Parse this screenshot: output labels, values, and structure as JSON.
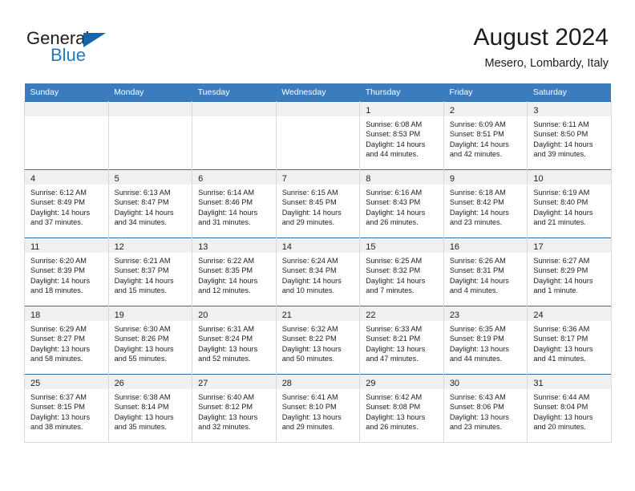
{
  "brand": {
    "name_part1": "General",
    "name_part2": "Blue",
    "flag_icon": "blue-triangle-flag-icon",
    "accent_color": "#1f7ac0"
  },
  "header": {
    "title": "August 2024",
    "subtitle": "Mesero, Lombardy, Italy"
  },
  "theme": {
    "header_row_bg": "#3a7cbe",
    "row_divider": "#2f6da8",
    "daynum_bar_bg": "#f0f0f0",
    "cell_border": "#d9d9d9"
  },
  "calendar": {
    "weekday_headers": [
      "Sunday",
      "Monday",
      "Tuesday",
      "Wednesday",
      "Thursday",
      "Friday",
      "Saturday"
    ],
    "weeks": [
      [
        {
          "day": "",
          "sunrise": "",
          "sunset": "",
          "daylight1": "",
          "daylight2": "",
          "empty": true
        },
        {
          "day": "",
          "sunrise": "",
          "sunset": "",
          "daylight1": "",
          "daylight2": "",
          "empty": true
        },
        {
          "day": "",
          "sunrise": "",
          "sunset": "",
          "daylight1": "",
          "daylight2": "",
          "empty": true
        },
        {
          "day": "",
          "sunrise": "",
          "sunset": "",
          "daylight1": "",
          "daylight2": "",
          "empty": true
        },
        {
          "day": "1",
          "sunrise": "Sunrise: 6:08 AM",
          "sunset": "Sunset: 8:53 PM",
          "daylight1": "Daylight: 14 hours",
          "daylight2": "and 44 minutes.",
          "empty": false
        },
        {
          "day": "2",
          "sunrise": "Sunrise: 6:09 AM",
          "sunset": "Sunset: 8:51 PM",
          "daylight1": "Daylight: 14 hours",
          "daylight2": "and 42 minutes.",
          "empty": false
        },
        {
          "day": "3",
          "sunrise": "Sunrise: 6:11 AM",
          "sunset": "Sunset: 8:50 PM",
          "daylight1": "Daylight: 14 hours",
          "daylight2": "and 39 minutes.",
          "empty": false
        }
      ],
      [
        {
          "day": "4",
          "sunrise": "Sunrise: 6:12 AM",
          "sunset": "Sunset: 8:49 PM",
          "daylight1": "Daylight: 14 hours",
          "daylight2": "and 37 minutes.",
          "empty": false
        },
        {
          "day": "5",
          "sunrise": "Sunrise: 6:13 AM",
          "sunset": "Sunset: 8:47 PM",
          "daylight1": "Daylight: 14 hours",
          "daylight2": "and 34 minutes.",
          "empty": false
        },
        {
          "day": "6",
          "sunrise": "Sunrise: 6:14 AM",
          "sunset": "Sunset: 8:46 PM",
          "daylight1": "Daylight: 14 hours",
          "daylight2": "and 31 minutes.",
          "empty": false
        },
        {
          "day": "7",
          "sunrise": "Sunrise: 6:15 AM",
          "sunset": "Sunset: 8:45 PM",
          "daylight1": "Daylight: 14 hours",
          "daylight2": "and 29 minutes.",
          "empty": false
        },
        {
          "day": "8",
          "sunrise": "Sunrise: 6:16 AM",
          "sunset": "Sunset: 8:43 PM",
          "daylight1": "Daylight: 14 hours",
          "daylight2": "and 26 minutes.",
          "empty": false
        },
        {
          "day": "9",
          "sunrise": "Sunrise: 6:18 AM",
          "sunset": "Sunset: 8:42 PM",
          "daylight1": "Daylight: 14 hours",
          "daylight2": "and 23 minutes.",
          "empty": false
        },
        {
          "day": "10",
          "sunrise": "Sunrise: 6:19 AM",
          "sunset": "Sunset: 8:40 PM",
          "daylight1": "Daylight: 14 hours",
          "daylight2": "and 21 minutes.",
          "empty": false
        }
      ],
      [
        {
          "day": "11",
          "sunrise": "Sunrise: 6:20 AM",
          "sunset": "Sunset: 8:39 PM",
          "daylight1": "Daylight: 14 hours",
          "daylight2": "and 18 minutes.",
          "empty": false
        },
        {
          "day": "12",
          "sunrise": "Sunrise: 6:21 AM",
          "sunset": "Sunset: 8:37 PM",
          "daylight1": "Daylight: 14 hours",
          "daylight2": "and 15 minutes.",
          "empty": false
        },
        {
          "day": "13",
          "sunrise": "Sunrise: 6:22 AM",
          "sunset": "Sunset: 8:35 PM",
          "daylight1": "Daylight: 14 hours",
          "daylight2": "and 12 minutes.",
          "empty": false
        },
        {
          "day": "14",
          "sunrise": "Sunrise: 6:24 AM",
          "sunset": "Sunset: 8:34 PM",
          "daylight1": "Daylight: 14 hours",
          "daylight2": "and 10 minutes.",
          "empty": false
        },
        {
          "day": "15",
          "sunrise": "Sunrise: 6:25 AM",
          "sunset": "Sunset: 8:32 PM",
          "daylight1": "Daylight: 14 hours",
          "daylight2": "and 7 minutes.",
          "empty": false
        },
        {
          "day": "16",
          "sunrise": "Sunrise: 6:26 AM",
          "sunset": "Sunset: 8:31 PM",
          "daylight1": "Daylight: 14 hours",
          "daylight2": "and 4 minutes.",
          "empty": false
        },
        {
          "day": "17",
          "sunrise": "Sunrise: 6:27 AM",
          "sunset": "Sunset: 8:29 PM",
          "daylight1": "Daylight: 14 hours",
          "daylight2": "and 1 minute.",
          "empty": false
        }
      ],
      [
        {
          "day": "18",
          "sunrise": "Sunrise: 6:29 AM",
          "sunset": "Sunset: 8:27 PM",
          "daylight1": "Daylight: 13 hours",
          "daylight2": "and 58 minutes.",
          "empty": false
        },
        {
          "day": "19",
          "sunrise": "Sunrise: 6:30 AM",
          "sunset": "Sunset: 8:26 PM",
          "daylight1": "Daylight: 13 hours",
          "daylight2": "and 55 minutes.",
          "empty": false
        },
        {
          "day": "20",
          "sunrise": "Sunrise: 6:31 AM",
          "sunset": "Sunset: 8:24 PM",
          "daylight1": "Daylight: 13 hours",
          "daylight2": "and 52 minutes.",
          "empty": false
        },
        {
          "day": "21",
          "sunrise": "Sunrise: 6:32 AM",
          "sunset": "Sunset: 8:22 PM",
          "daylight1": "Daylight: 13 hours",
          "daylight2": "and 50 minutes.",
          "empty": false
        },
        {
          "day": "22",
          "sunrise": "Sunrise: 6:33 AM",
          "sunset": "Sunset: 8:21 PM",
          "daylight1": "Daylight: 13 hours",
          "daylight2": "and 47 minutes.",
          "empty": false
        },
        {
          "day": "23",
          "sunrise": "Sunrise: 6:35 AM",
          "sunset": "Sunset: 8:19 PM",
          "daylight1": "Daylight: 13 hours",
          "daylight2": "and 44 minutes.",
          "empty": false
        },
        {
          "day": "24",
          "sunrise": "Sunrise: 6:36 AM",
          "sunset": "Sunset: 8:17 PM",
          "daylight1": "Daylight: 13 hours",
          "daylight2": "and 41 minutes.",
          "empty": false
        }
      ],
      [
        {
          "day": "25",
          "sunrise": "Sunrise: 6:37 AM",
          "sunset": "Sunset: 8:15 PM",
          "daylight1": "Daylight: 13 hours",
          "daylight2": "and 38 minutes.",
          "empty": false
        },
        {
          "day": "26",
          "sunrise": "Sunrise: 6:38 AM",
          "sunset": "Sunset: 8:14 PM",
          "daylight1": "Daylight: 13 hours",
          "daylight2": "and 35 minutes.",
          "empty": false
        },
        {
          "day": "27",
          "sunrise": "Sunrise: 6:40 AM",
          "sunset": "Sunset: 8:12 PM",
          "daylight1": "Daylight: 13 hours",
          "daylight2": "and 32 minutes.",
          "empty": false
        },
        {
          "day": "28",
          "sunrise": "Sunrise: 6:41 AM",
          "sunset": "Sunset: 8:10 PM",
          "daylight1": "Daylight: 13 hours",
          "daylight2": "and 29 minutes.",
          "empty": false
        },
        {
          "day": "29",
          "sunrise": "Sunrise: 6:42 AM",
          "sunset": "Sunset: 8:08 PM",
          "daylight1": "Daylight: 13 hours",
          "daylight2": "and 26 minutes.",
          "empty": false
        },
        {
          "day": "30",
          "sunrise": "Sunrise: 6:43 AM",
          "sunset": "Sunset: 8:06 PM",
          "daylight1": "Daylight: 13 hours",
          "daylight2": "and 23 minutes.",
          "empty": false
        },
        {
          "day": "31",
          "sunrise": "Sunrise: 6:44 AM",
          "sunset": "Sunset: 8:04 PM",
          "daylight1": "Daylight: 13 hours",
          "daylight2": "and 20 minutes.",
          "empty": false
        }
      ]
    ]
  }
}
